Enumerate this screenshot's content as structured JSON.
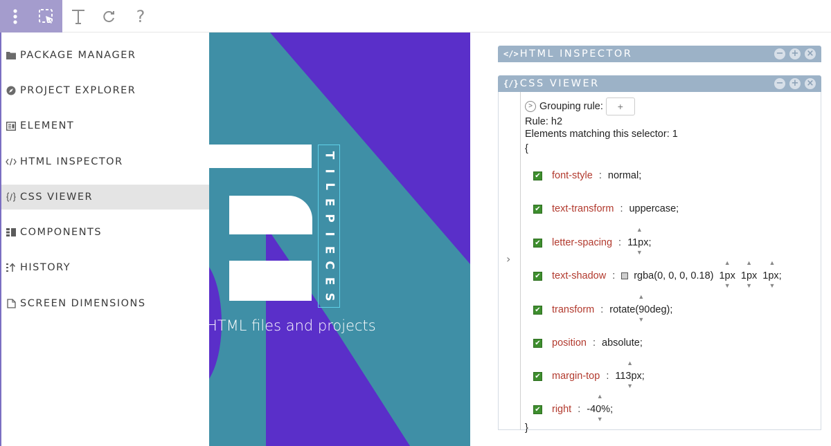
{
  "toolbar": {
    "icons": [
      "menu-dots-icon",
      "select-element-icon",
      "text-tool-icon",
      "refresh-icon"
    ],
    "help_label": "?"
  },
  "sidebar": {
    "items": [
      {
        "icon": "folder-icon",
        "label": "PACKAGE MANAGER"
      },
      {
        "icon": "compass-icon",
        "label": "PROJECT EXPLORER"
      },
      {
        "icon": "element-icon",
        "label": "ELEMENT"
      },
      {
        "icon": "code-icon",
        "label": "HTML INSPECTOR"
      },
      {
        "icon": "css-icon",
        "label": "CSS VIEWER",
        "active": true
      },
      {
        "icon": "components-icon",
        "label": "COMPONENTS"
      },
      {
        "icon": "history-icon",
        "label": "HISTORY"
      },
      {
        "icon": "screen-icon",
        "label": "SCREEN DIMENSIONS"
      }
    ]
  },
  "canvas": {
    "vertical_text": "TILEPIECES",
    "subtitle": "HTML files and projects",
    "colors": {
      "purple": "#5a2fc9",
      "teal": "#3f8fa6",
      "white": "#ffffff"
    }
  },
  "html_inspector": {
    "icon": "</>",
    "title": "HTML INSPECTOR"
  },
  "css_viewer": {
    "icon": "{/}",
    "title": "CSS VIEWER",
    "grouping_label": "Grouping rule:",
    "grouping_button": "+",
    "rule": "Rule: h2",
    "matching": "Elements matching this selector: 1",
    "open_brace": "{",
    "close_brace": "}",
    "properties": [
      {
        "name": "font-style",
        "value": "normal;"
      },
      {
        "name": "text-transform",
        "value": "uppercase;"
      },
      {
        "name": "letter-spacing",
        "value": "11px;"
      },
      {
        "name": "text-shadow",
        "value": "rgba(0, 0, 0, 0.18)",
        "v1": "1px",
        "v2": "1px",
        "v3": "1px;"
      },
      {
        "name": "transform",
        "value": "rotate(90deg);"
      },
      {
        "name": "position",
        "value": "absolute;"
      },
      {
        "name": "margin-top",
        "value": "113px;"
      },
      {
        "name": "right",
        "value": "-40%;"
      }
    ],
    "panel_controls": [
      "−",
      "+",
      "×"
    ]
  },
  "colors": {
    "toolbar_active": "#a49ccd",
    "panel_header": "#9cb2c7",
    "property_name": "#b23a2e",
    "checkbox": "#3e8e2e"
  }
}
